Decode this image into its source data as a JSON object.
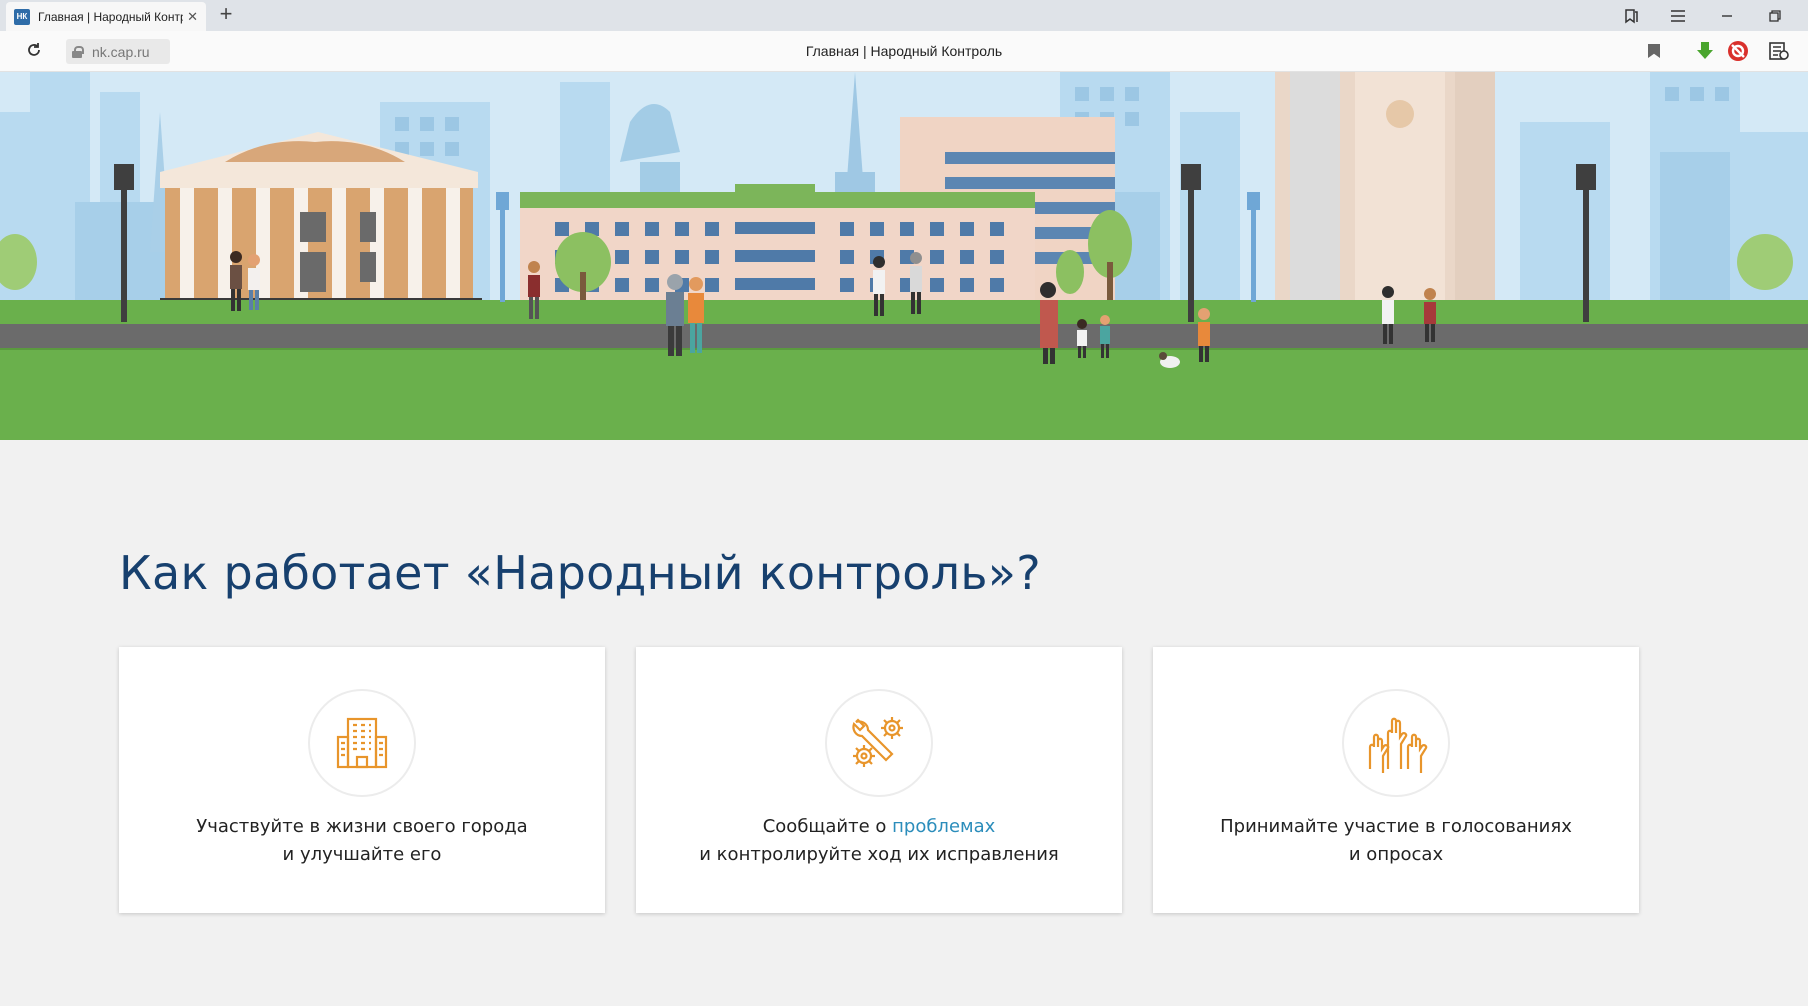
{
  "browser": {
    "tab_title": "Главная | Народный Контроль",
    "favicon_text": "НК",
    "url": "nk.cap.ru",
    "page_title": "Главная | Народный Контроль"
  },
  "main": {
    "heading": "Как работает «Народный контроль»?",
    "cards": [
      {
        "line1": "Участвуйте в жизни своего города",
        "line2": "и улучшайте его",
        "icon": "city-building-icon"
      },
      {
        "line1_prefix": "Сообщайте о ",
        "line1_link": "проблемах",
        "line2": "и контролируйте ход их исправления",
        "icon": "tools-gears-icon"
      },
      {
        "line1": "Принимайте участие в голосованиях",
        "line2": "и опросах",
        "icon": "raised-hands-icon"
      }
    ]
  },
  "colors": {
    "heading": "#17406e",
    "accent_orange": "#e8952b",
    "link": "#2b8dbb",
    "grass": "#6ab04c",
    "road": "#6b6b6b"
  }
}
